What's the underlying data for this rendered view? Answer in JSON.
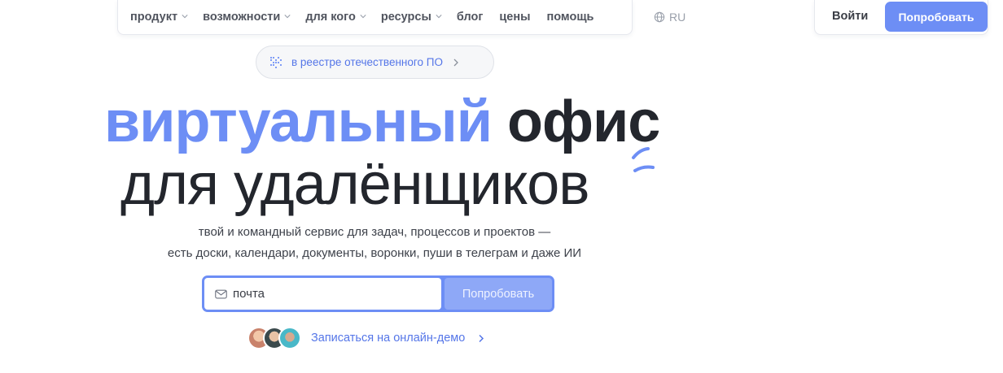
{
  "nav": {
    "items": [
      {
        "label": "продукт",
        "dropdown": true
      },
      {
        "label": "возможности",
        "dropdown": true
      },
      {
        "label": "для кого",
        "dropdown": true
      },
      {
        "label": "ресурсы",
        "dropdown": true
      },
      {
        "label": "блог",
        "dropdown": false
      },
      {
        "label": "цены",
        "dropdown": false
      },
      {
        "label": "помощь",
        "dropdown": false
      }
    ],
    "lang": "RU",
    "lang_icon": "globe-icon"
  },
  "auth": {
    "login_label": "Войти",
    "try_label": "Попробовать"
  },
  "registry_chip": {
    "label": "в реестре отечественного ПО",
    "icon": "grid-dots-icon"
  },
  "hero": {
    "title_accent": "виртуальный",
    "title_rest": "офис",
    "title_line2": "для удалёнщиков",
    "subtitle_line1": "твой и командный сервис для задач, процессов и проектов —",
    "subtitle_line2": "есть доски, календари, документы, воронки, пуши в телеграм и даже ИИ"
  },
  "form": {
    "email_placeholder": "почта",
    "email_icon": "mail-icon",
    "submit_label": "Попробовать"
  },
  "demo": {
    "label": "Записаться на онлайн-демо"
  },
  "colors": {
    "accent": "#6d8ef5",
    "accent_light": "#8ea8f7",
    "text_dark": "#23262d",
    "link": "#5576e8"
  }
}
